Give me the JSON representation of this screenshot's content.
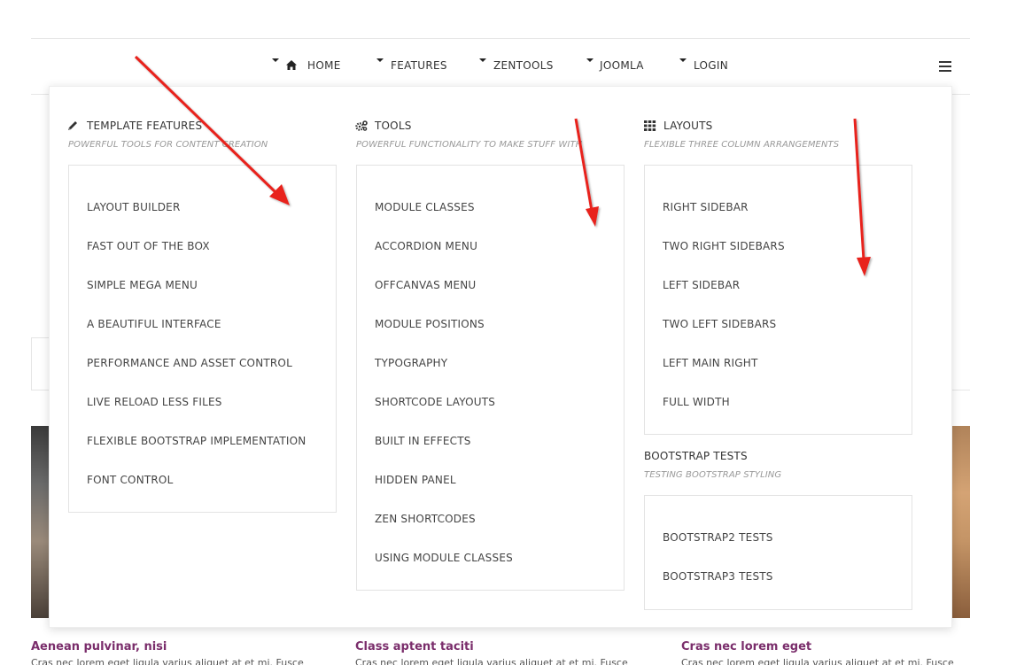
{
  "nav": {
    "items": [
      {
        "label": "HOME",
        "icon": "home-icon"
      },
      {
        "label": "FEATURES"
      },
      {
        "label": "ZENTOOLS"
      },
      {
        "label": "JOOMLA"
      },
      {
        "label": "LOGIN"
      }
    ],
    "menu_icon": "hamburger-icon"
  },
  "mega_menu": {
    "columns": [
      {
        "icon": "pencil-icon",
        "title": "TEMPLATE FEATURES",
        "subtitle": "POWERFUL TOOLS FOR CONTENT CREATION",
        "items": [
          "LAYOUT BUILDER",
          "FAST OUT OF THE BOX",
          "SIMPLE MEGA MENU",
          "A BEAUTIFUL INTERFACE",
          "PERFORMANCE AND ASSET CONTROL",
          "LIVE RELOAD LESS FILES",
          "FLEXIBLE BOOTSTRAP IMPLEMENTATION",
          "FONT CONTROL"
        ]
      },
      {
        "icon": "gears-icon",
        "title": "TOOLS",
        "subtitle": "POWERFUL FUNCTIONALITY TO MAKE STUFF WITH",
        "items": [
          "MODULE CLASSES",
          "ACCORDION MENU",
          "OFFCANVAS MENU",
          "MODULE POSITIONS",
          "TYPOGRAPHY",
          "SHORTCODE LAYOUTS",
          "BUILT IN EFFECTS",
          "HIDDEN PANEL",
          "ZEN SHORTCODES",
          "USING MODULE CLASSES"
        ]
      },
      {
        "icon": "grid-icon",
        "title": "LAYOUTS",
        "subtitle": "FLEXIBLE THREE COLUMN ARRANGEMENTS",
        "items": [
          "RIGHT SIDEBAR",
          "TWO RIGHT SIDEBARS",
          "LEFT SIDEBAR",
          "TWO LEFT SIDEBARS",
          "LEFT MAIN RIGHT",
          "FULL WIDTH"
        ]
      }
    ],
    "bootstrap": {
      "title": "BOOTSTRAP TESTS",
      "subtitle": "TESTING BOOTSTRAP STYLING",
      "items": [
        "BOOTSTRAP2 TESTS",
        "BOOTSTRAP3 TESTS"
      ]
    }
  },
  "articles": [
    {
      "title": "Aenean pulvinar, nisi",
      "excerpt": "Cras nec lorem eget ligula varius aliquet at et mi. Fusce"
    },
    {
      "title": "Class aptent taciti",
      "excerpt": "Cras nec lorem eget ligula varius aliquet at et mi. Fusce"
    },
    {
      "title": "Cras nec lorem eget",
      "excerpt": "Cras nec lorem eget ligula varius aliquet at et mi. Fusce"
    }
  ],
  "colors": {
    "arrow": "#e8231f",
    "article_title": "#7a2d6b"
  }
}
